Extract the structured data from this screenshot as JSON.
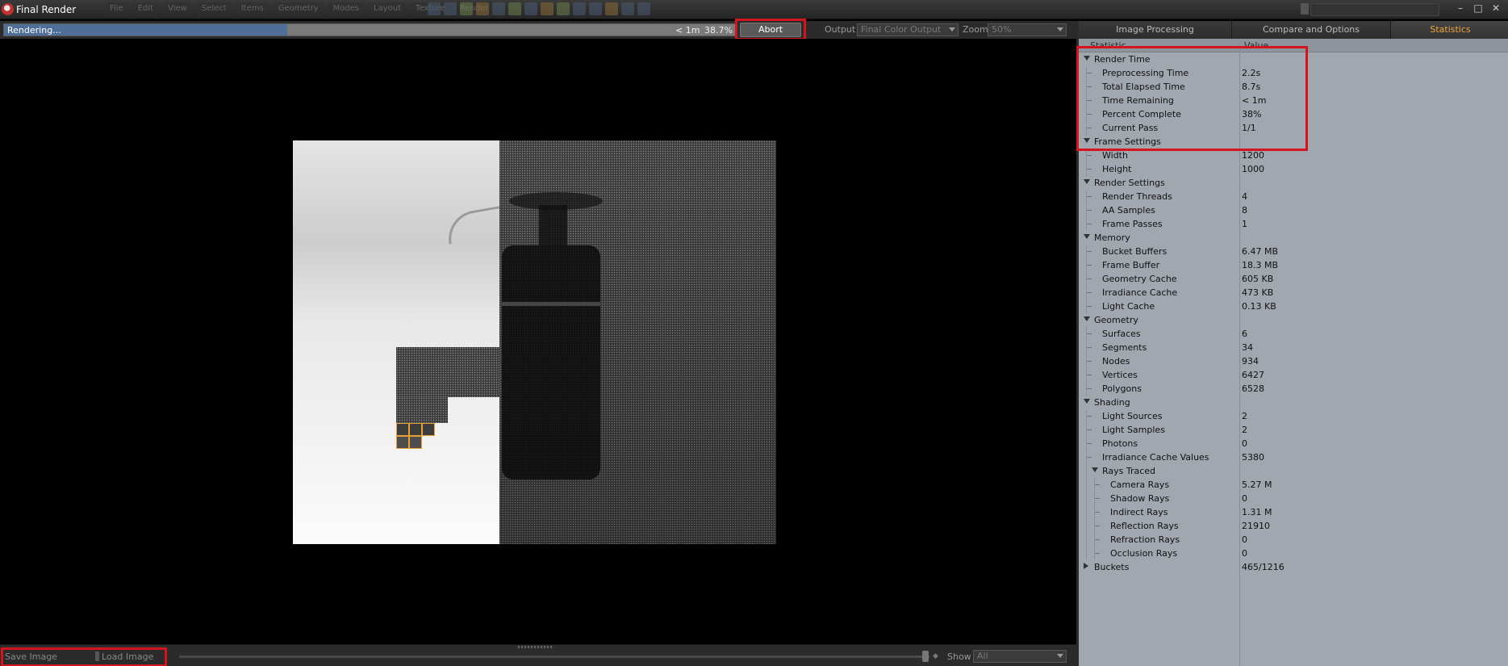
{
  "window": {
    "title": "Final Render"
  },
  "background_menu": [
    "File",
    "Edit",
    "View",
    "Select",
    "Items",
    "Geometry",
    "Modes",
    "Layout",
    "Texture",
    "Render"
  ],
  "render_bar": {
    "status": "Rendering...",
    "progress": 0.387,
    "time_remaining": "< 1m",
    "percent_text": "38.7%",
    "abort_label": "Abort",
    "output_label": "Output",
    "output_value": "Final Color Output",
    "zoom_label": "Zoom",
    "zoom_value": "50%"
  },
  "bottom_bar": {
    "save_label": "Save Image",
    "load_label": "Load Image",
    "show_label": "Show",
    "show_value": "All"
  },
  "panel": {
    "tabs": [
      {
        "label": "Image Processing",
        "active": false
      },
      {
        "label": "Compare and Options",
        "active": false
      },
      {
        "label": "Statistics",
        "active": true
      }
    ],
    "columns": {
      "statistic": "Statistic",
      "value": "Value"
    },
    "rows": [
      {
        "label": "Render Time",
        "value": "",
        "level": 0,
        "type": "group-open"
      },
      {
        "label": "Preprocessing Time",
        "value": "2.2s",
        "level": 1,
        "type": "leaf"
      },
      {
        "label": "Total Elapsed Time",
        "value": "8.7s",
        "level": 1,
        "type": "leaf"
      },
      {
        "label": "Time Remaining",
        "value": "< 1m",
        "level": 1,
        "type": "leaf"
      },
      {
        "label": "Percent Complete",
        "value": "38%",
        "level": 1,
        "type": "leaf"
      },
      {
        "label": "Current Pass",
        "value": "1/1",
        "level": 1,
        "type": "leaf"
      },
      {
        "label": "Frame Settings",
        "value": "",
        "level": 0,
        "type": "group-open"
      },
      {
        "label": "Width",
        "value": "1200",
        "level": 1,
        "type": "leaf"
      },
      {
        "label": "Height",
        "value": "1000",
        "level": 1,
        "type": "leaf"
      },
      {
        "label": "Render Settings",
        "value": "",
        "level": 0,
        "type": "group-open"
      },
      {
        "label": "Render Threads",
        "value": "4",
        "level": 1,
        "type": "leaf"
      },
      {
        "label": "AA Samples",
        "value": "8",
        "level": 1,
        "type": "leaf"
      },
      {
        "label": "Frame Passes",
        "value": "1",
        "level": 1,
        "type": "leaf"
      },
      {
        "label": "Memory",
        "value": "",
        "level": 0,
        "type": "group-open"
      },
      {
        "label": "Bucket Buffers",
        "value": "6.47 MB",
        "level": 1,
        "type": "leaf"
      },
      {
        "label": "Frame Buffer",
        "value": "18.3 MB",
        "level": 1,
        "type": "leaf"
      },
      {
        "label": "Geometry Cache",
        "value": "605 KB",
        "level": 1,
        "type": "leaf"
      },
      {
        "label": "Irradiance Cache",
        "value": "473 KB",
        "level": 1,
        "type": "leaf"
      },
      {
        "label": "Light Cache",
        "value": "0.13 KB",
        "level": 1,
        "type": "leaf"
      },
      {
        "label": "Geometry",
        "value": "",
        "level": 0,
        "type": "group-open"
      },
      {
        "label": "Surfaces",
        "value": "6",
        "level": 1,
        "type": "leaf"
      },
      {
        "label": "Segments",
        "value": "34",
        "level": 1,
        "type": "leaf"
      },
      {
        "label": "Nodes",
        "value": "934",
        "level": 1,
        "type": "leaf"
      },
      {
        "label": "Vertices",
        "value": "6427",
        "level": 1,
        "type": "leaf"
      },
      {
        "label": "Polygons",
        "value": "6528",
        "level": 1,
        "type": "leaf"
      },
      {
        "label": "Shading",
        "value": "",
        "level": 0,
        "type": "group-open"
      },
      {
        "label": "Light Sources",
        "value": "2",
        "level": 1,
        "type": "leaf"
      },
      {
        "label": "Light Samples",
        "value": "2",
        "level": 1,
        "type": "leaf"
      },
      {
        "label": "Photons",
        "value": "0",
        "level": 1,
        "type": "leaf"
      },
      {
        "label": "Irradiance Cache Values",
        "value": "5380",
        "level": 1,
        "type": "leaf"
      },
      {
        "label": "Rays Traced",
        "value": "",
        "level": 1,
        "type": "group-open"
      },
      {
        "label": "Camera Rays",
        "value": "5.27 M",
        "level": 2,
        "type": "leaf"
      },
      {
        "label": "Shadow Rays",
        "value": "0",
        "level": 2,
        "type": "leaf"
      },
      {
        "label": "Indirect Rays",
        "value": "1.31 M",
        "level": 2,
        "type": "leaf"
      },
      {
        "label": "Reflection Rays",
        "value": "21910",
        "level": 2,
        "type": "leaf"
      },
      {
        "label": "Refraction Rays",
        "value": "0",
        "level": 2,
        "type": "leaf"
      },
      {
        "label": "Occlusion Rays",
        "value": "0",
        "level": 2,
        "type": "leaf"
      },
      {
        "label": "Buckets",
        "value": "465/1216",
        "level": 0,
        "type": "group-closed"
      }
    ]
  },
  "colors": {
    "accent_tab": "#f2a33a",
    "progress_fill": "#4f6e98",
    "highlight_box": "#d4141f",
    "active_bucket": "#e8a030",
    "panel_bg": "#a1a7ae"
  }
}
